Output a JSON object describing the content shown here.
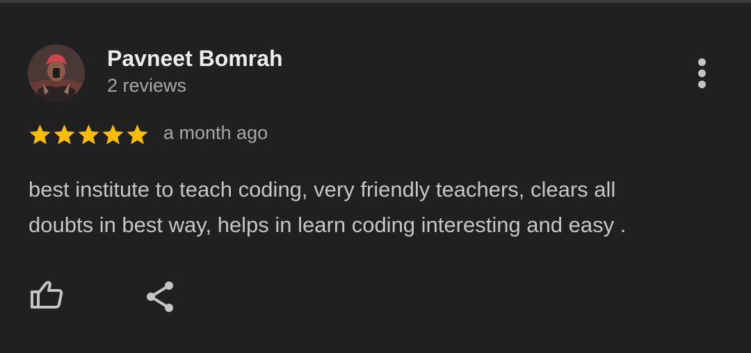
{
  "review": {
    "reviewer_name": "Pavneet Bomrah",
    "review_count": "2 reviews",
    "rating": 5,
    "max_rating": 5,
    "date": "a month ago",
    "text_lines": [
      "best institute to teach coding, very friendly teachers, clears all",
      "doubts in best way, helps in learn coding interesting and easy ."
    ]
  },
  "icons": {
    "avatar": "profile-photo",
    "more": "more-vert-icon",
    "star": "star-icon",
    "like": "thumb-up-icon",
    "share": "share-icon"
  },
  "colors": {
    "background": "#202020",
    "star": "#f8bc0b",
    "primary_text": "#ececec",
    "secondary_text": "#a8a8a8",
    "body_text": "#c6c6c6",
    "icon": "#c4c4c4"
  }
}
